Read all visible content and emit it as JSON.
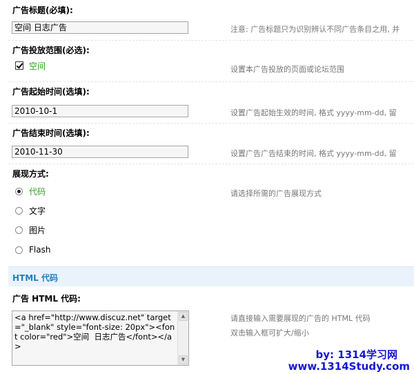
{
  "fields": {
    "title": {
      "label": "广告标题(必填):",
      "value": "空间  日志广告",
      "hint": "注意: 广告标题只为识别辨认不同广告条目之用, 并"
    },
    "scope": {
      "label": "广告投放范围(必选):",
      "option": "空间",
      "hint": "设置本广告投放的页面或论坛范围"
    },
    "start_time": {
      "label": "广告起始时间(选填):",
      "value": "2010-10-1",
      "hint": "设置广告起始生效的时间, 格式  yyyy-mm-dd, 留"
    },
    "end_time": {
      "label": "广告结束时间(选填):",
      "value": "2010-11-30",
      "hint": "设置广告广告结束的时间, 格式  yyyy-mm-dd, 留"
    },
    "display_mode": {
      "label": "展现方式:",
      "hint": "请选择所需的广告展现方式",
      "options": [
        "代码",
        "文字",
        "图片",
        "Flash"
      ],
      "selected": "代码"
    }
  },
  "html_section": {
    "title": "HTML 代码",
    "label": "广告  HTML 代码:",
    "code": "<a href=\"http://www.discuz.net\" target=\"_blank\" style=\"font-size: 20px\"><font color=\"red\">空间  日志广告</font></a>",
    "hint_line1": "请直接输入需要展现的广告的  HTML 代码",
    "hint_line2": "双击输入框可扩大/缩小"
  },
  "watermark": {
    "line1": "by: 1314学习网",
    "line2": "www.1314Study.com"
  },
  "colors": {
    "accent": "#1f7fc0",
    "selected_option": "#2aa31a",
    "watermark": "#1515d6"
  }
}
